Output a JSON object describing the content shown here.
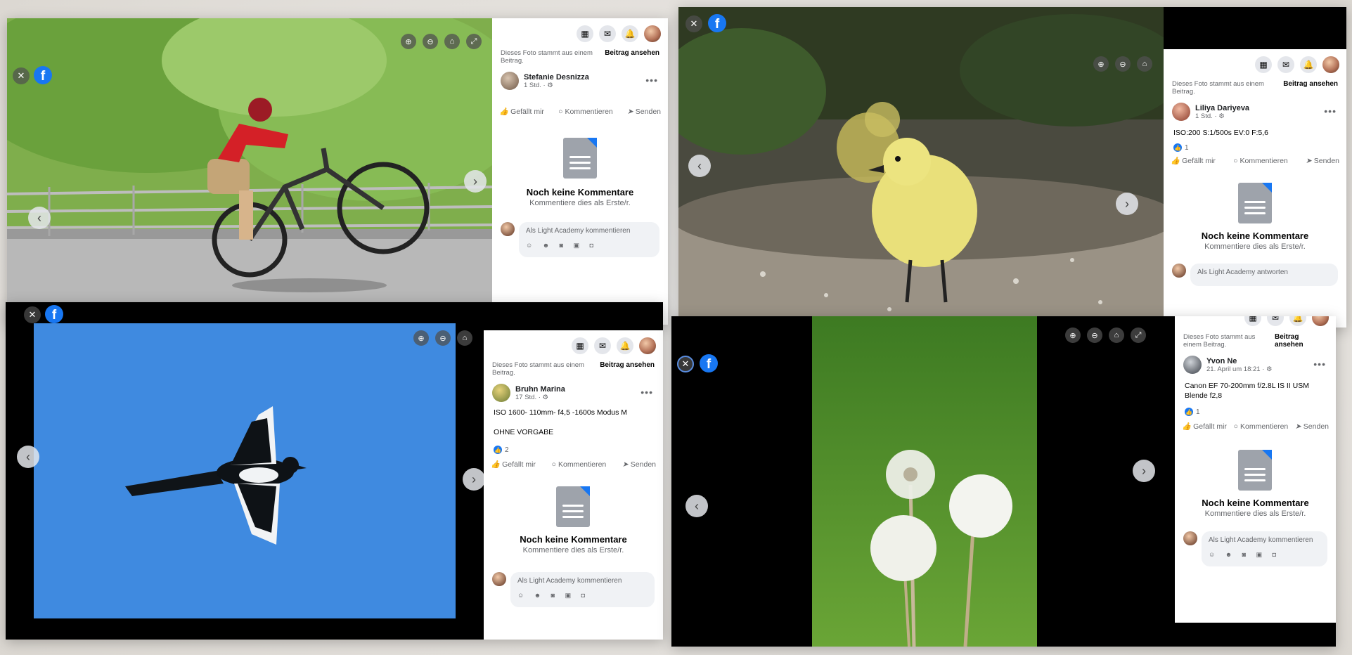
{
  "common": {
    "origin_text": "Dieses Foto stammt aus einem Beitrag.",
    "view_post": "Beitrag ansehen",
    "like": "Gefällt mir",
    "comment": "Kommentieren",
    "send": "Senden",
    "no_comments_title": "Noch keine Kommentare",
    "no_comments_sub": "Kommentiere dies als Erste/r.",
    "fb_letter": "f",
    "close_glyph": "✕",
    "prev_glyph": "‹",
    "next_glyph": "›",
    "more_glyph": "•••",
    "grid_glyph": "▦",
    "messenger_glyph": "✉",
    "bell_glyph": "🔔",
    "like_glyph": "👍",
    "comment_glyph": "○",
    "send_glyph": "➤",
    "zoom_in_glyph": "⊕",
    "zoom_out_glyph": "⊖",
    "tag_glyph": "⌂",
    "fullscreen_glyph": "⤢",
    "emoji_row": "☺ ☻ ◙ ▣ ◘"
  },
  "panels": [
    {
      "id": "bike",
      "author": "Stefanie Desnizza",
      "time": "1 Std. · ⚙",
      "caption": "",
      "likes": "",
      "comment_placeholder": "Als Light Academy kommentieren"
    },
    {
      "id": "gosling",
      "author": "Liliya Dariyeva",
      "time": "1 Std. · ⚙",
      "caption": "ISO:200 S:1/500s EV:0 F:5,6",
      "likes": "1",
      "comment_placeholder": "Als Light Academy antworten"
    },
    {
      "id": "magpie",
      "author": "Bruhn Marina",
      "time": "17 Std. · ⚙",
      "caption": "ISO 1600- 110mm- f4,5 -1600s Modus M\n\nOHNE VORGABE",
      "likes": "2",
      "comment_placeholder": "Als Light Academy kommentieren"
    },
    {
      "id": "dandelion",
      "author": "Yvon Ne",
      "time": "21. April um 18:21 · ⚙",
      "caption": "Canon EF 70-200mm f/2.8L IS II USM\nBlende f2,8",
      "likes": "1",
      "comment_placeholder": "Als Light Academy kommentieren"
    }
  ]
}
